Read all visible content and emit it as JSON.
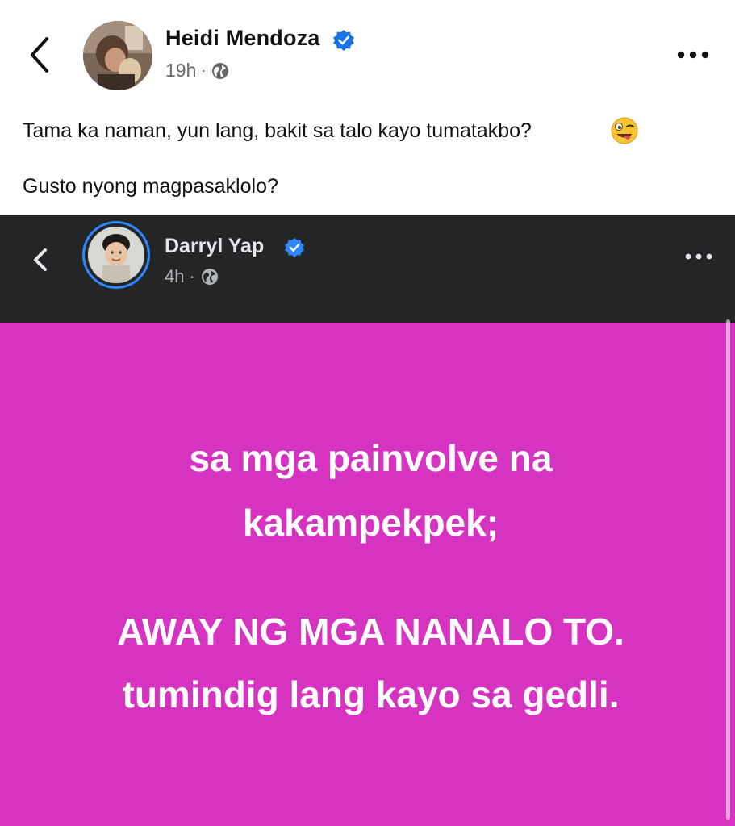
{
  "post": {
    "author_name": "Heidi Mendoza",
    "time": "19h",
    "separator": "·",
    "text_line1": "Tama ka naman, yun lang, bakit sa talo kayo tumatakbo?",
    "text_line2": "Gusto nyong magpasaklolo?",
    "emoji_name": "zany-face-emoji"
  },
  "embedded_post": {
    "author_name": "Darryl Yap",
    "time": "4h",
    "separator": "·",
    "card_background": "#d633c0",
    "card_lines": [
      "sa mga painvolve na",
      "kakampekpek;",
      "AWAY NG MGA NANALO TO.",
      "tumindig lang kayo sa gedli."
    ]
  },
  "colors": {
    "verified_blue": "#1b74e4",
    "dark_header": "#242526",
    "meta_gray": "#65676b"
  }
}
